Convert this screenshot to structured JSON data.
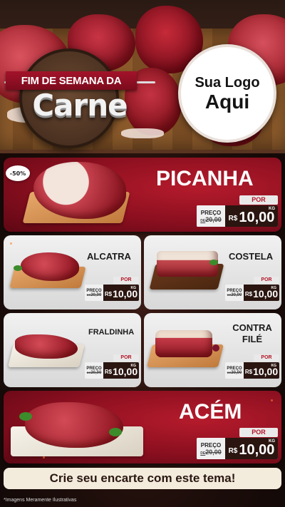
{
  "hero": {
    "ribbon_text": "FIM DE SEMANA DA",
    "title": "Carne",
    "logo_line1": "Sua Logo",
    "logo_line2": "Aqui"
  },
  "featured": [
    {
      "name": "PICANHA",
      "discount": "-50%",
      "tag": {
        "por": "POR",
        "preco": "PREÇO",
        "de": "DE",
        "old": "20,00",
        "currency": "R$",
        "price": "10,00",
        "unit": "KG"
      }
    },
    {
      "name": "ACÉM",
      "tag": {
        "por": "POR",
        "preco": "PREÇO",
        "de": "DE",
        "old": "20,00",
        "currency": "R$",
        "price": "10,00",
        "unit": "KG"
      }
    }
  ],
  "grid": [
    {
      "name": "ALCATRA",
      "tag": {
        "por": "POR",
        "preco": "PREÇO",
        "de": "DE",
        "old": "20,00",
        "currency": "R$",
        "price": "10,00",
        "unit": "KG"
      }
    },
    {
      "name": "COSTELA",
      "tag": {
        "por": "POR",
        "preco": "PREÇO",
        "de": "DE",
        "old": "20,00",
        "currency": "R$",
        "price": "10,00",
        "unit": "KG"
      }
    },
    {
      "name": "FRALDINHA",
      "tag": {
        "por": "POR",
        "preco": "PREÇO",
        "de": "DE",
        "old": "20,00",
        "currency": "R$",
        "price": "10,00",
        "unit": "KG"
      }
    },
    {
      "name_line1": "CONTRA",
      "name_line2": "FILÉ",
      "tag": {
        "por": "POR",
        "preco": "PREÇO",
        "de": "DE",
        "old": "20,00",
        "currency": "R$",
        "price": "10,00",
        "unit": "KG"
      }
    }
  ],
  "cta": "Crie seu encarte com este tema!",
  "footer": "*Imagens Meramente Ilustrativas",
  "colors": {
    "accent_red": "#8a0f1f",
    "card_gray": "#e4e4e4",
    "price_dark": "#2a1510"
  }
}
